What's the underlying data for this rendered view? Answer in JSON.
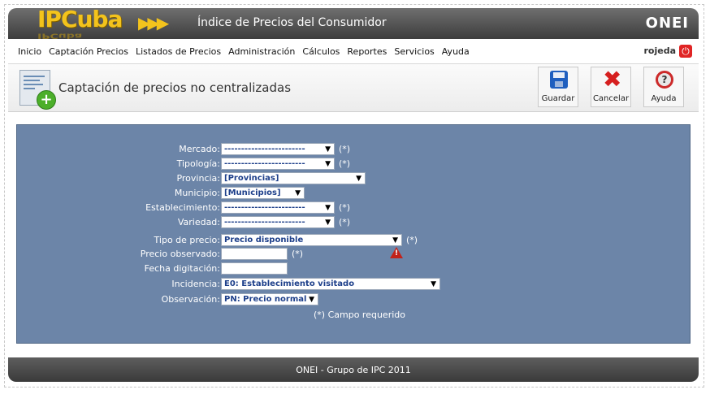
{
  "header": {
    "logo": "IPCuba",
    "title": "Índice de Precios del Consumidor",
    "brand": "ONEI"
  },
  "menu": [
    "Inicio",
    "Captación Precios",
    "Listados de Precios",
    "Administración",
    "Cálculos",
    "Reportes",
    "Servicios",
    "Ayuda"
  ],
  "user": {
    "name": "rojeda"
  },
  "page": {
    "title": "Captación de precios no centralizadas"
  },
  "toolbar": {
    "save_label": "Guardar",
    "cancel_label": "Cancelar",
    "help_label": "Ayuda"
  },
  "form": {
    "mercado": {
      "label": "Mercado:",
      "value": "------------------------",
      "required": "(*)"
    },
    "tipologia": {
      "label": "Tipología:",
      "value": "------------------------",
      "required": "(*)"
    },
    "provincia": {
      "label": "Provincia:",
      "value": "[Provincias]"
    },
    "municipio": {
      "label": "Municipio:",
      "value": "[Municipios]"
    },
    "establecimiento": {
      "label": "Establecimiento:",
      "value": "------------------------",
      "required": "(*)"
    },
    "variedad": {
      "label": "Variedad:",
      "value": "------------------------",
      "required": "(*)"
    },
    "tipo_precio": {
      "label": "Tipo de precio:",
      "value": "Precio disponible",
      "required": "(*)"
    },
    "precio_observado": {
      "label": "Precio observado:",
      "value": "",
      "required": "(*)"
    },
    "fecha_digitacion": {
      "label": "Fecha digitación:",
      "value": ""
    },
    "incidencia": {
      "label": "Incidencia:",
      "value": "E0: Establecimiento visitado"
    },
    "observacion": {
      "label": "Observación:",
      "value": "PN: Precio normal"
    },
    "required_note": "(*) Campo requerido"
  },
  "footer": {
    "text": "ONEI - Grupo de IPC 2011"
  },
  "colors": {
    "panel": "#6c85a8",
    "header": "#4a4a4a",
    "accent": "#f3c31c"
  }
}
